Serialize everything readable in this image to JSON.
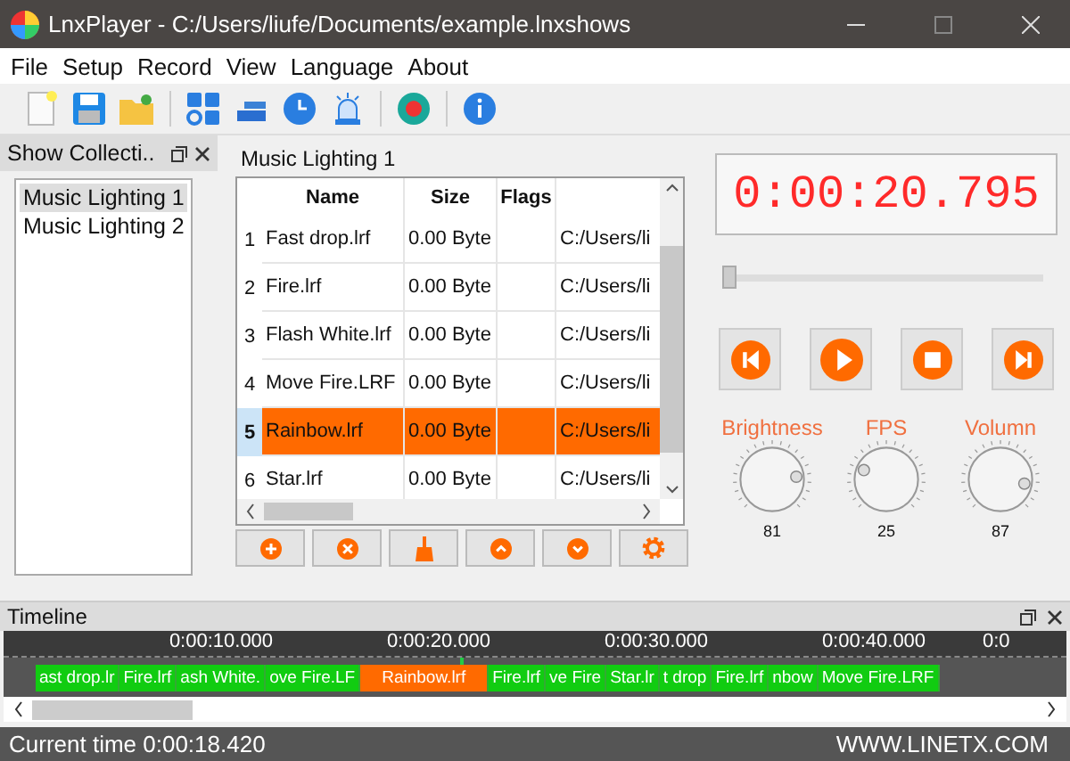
{
  "window": {
    "title": "LnxPlayer - C:/Users/liufe/Documents/example.lnxshows"
  },
  "menu": [
    "File",
    "Setup",
    "Record",
    "View",
    "Language",
    "About"
  ],
  "show_collection": {
    "title": "Show Collecti..",
    "items": [
      {
        "label": "Music Lighting 1",
        "selected": true
      },
      {
        "label": "Music Lighting 2",
        "selected": false
      }
    ]
  },
  "playlist": {
    "title": "Music Lighting 1",
    "columns": [
      "Name",
      "Size",
      "Flags"
    ],
    "rows": [
      {
        "number": "1",
        "name": "Fast drop.lrf",
        "size": "0.00 Byte",
        "path": "C:/Users/li",
        "selected": false
      },
      {
        "number": "2",
        "name": "Fire.lrf",
        "size": "0.00 Byte",
        "path": "C:/Users/li",
        "selected": false
      },
      {
        "number": "3",
        "name": "Flash White.lrf",
        "size": "0.00 Byte",
        "path": "C:/Users/li",
        "selected": false
      },
      {
        "number": "4",
        "name": "Move Fire.LRF",
        "size": "0.00 Byte",
        "path": "C:/Users/li",
        "selected": false
      },
      {
        "number": "5",
        "name": "Rainbow.lrf",
        "size": "0.00 Byte",
        "path": "C:/Users/li",
        "selected": true
      },
      {
        "number": "6",
        "name": "Star.lrf",
        "size": "0.00 Byte",
        "path": "C:/Users/li",
        "selected": false
      }
    ]
  },
  "player": {
    "display": "0:00:20.795",
    "position": {
      "level": 0
    },
    "knobs": [
      {
        "label": "Brightness",
        "value": "81",
        "level": 0.81
      },
      {
        "label": "FPS",
        "value": "25",
        "level": 0.25
      },
      {
        "label": "Volumn",
        "value": "87",
        "level": 0.87
      }
    ]
  },
  "timeline": {
    "title": "Timeline",
    "ticks": [
      "0:00:10.000",
      "0:00:20.000",
      "0:00:30.000",
      "0:00:40.000",
      "0:0"
    ],
    "clips": [
      {
        "label": "ast drop.lr",
        "selected": false
      },
      {
        "label": "Fire.lrf",
        "selected": false
      },
      {
        "label": "ash White.",
        "selected": false
      },
      {
        "label": "ove Fire.LF",
        "selected": false
      },
      {
        "label": "Rainbow.lrf",
        "selected": true
      },
      {
        "label": "Fire.lrf",
        "selected": false
      },
      {
        "label": "ve Fire",
        "selected": false
      },
      {
        "label": "Star.lr",
        "selected": false
      },
      {
        "label": "t drop",
        "selected": false
      },
      {
        "label": "Fire.lrf",
        "selected": false
      },
      {
        "label": "nbow",
        "selected": false
      },
      {
        "label": "Move Fire.LRF",
        "selected": false
      }
    ]
  },
  "status_bar": {
    "current_time": "Current time 0:00:18.420",
    "website": "WWW.LINETX.COM"
  }
}
